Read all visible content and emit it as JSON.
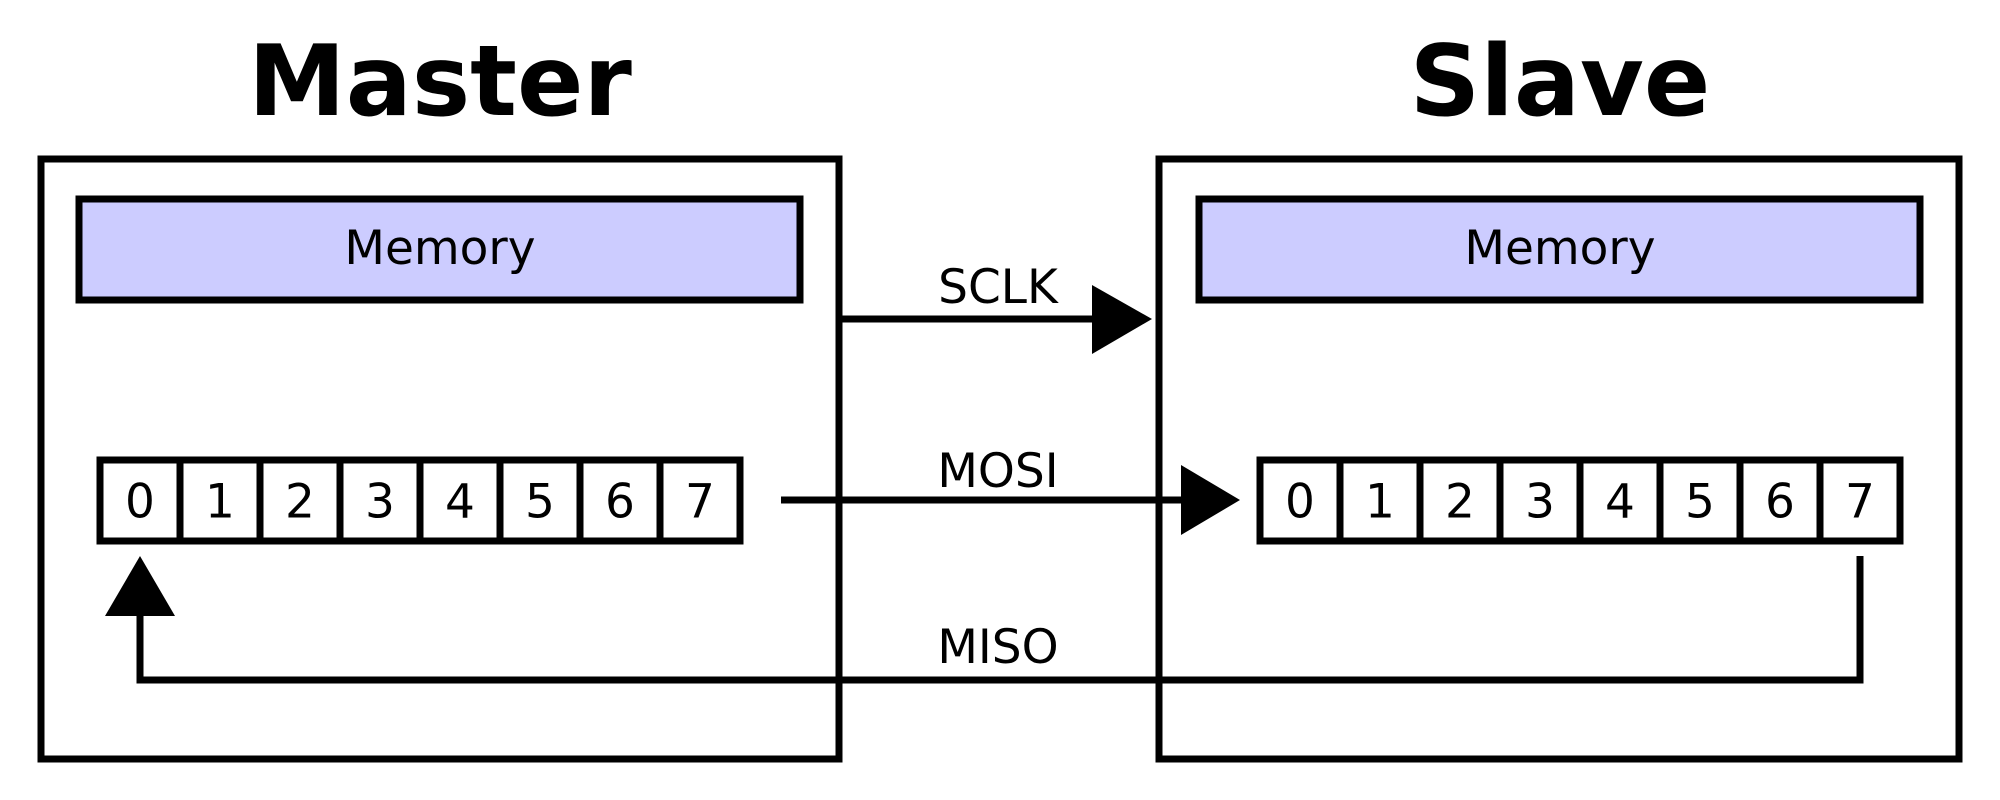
{
  "colors": {
    "memory_fill": "#ccccff",
    "line": "#000000",
    "background": "#ffffff"
  },
  "master": {
    "title": "Master",
    "memory_label": "Memory",
    "register_bits": [
      "0",
      "1",
      "2",
      "3",
      "4",
      "5",
      "6",
      "7"
    ]
  },
  "slave": {
    "title": "Slave",
    "memory_label": "Memory",
    "register_bits": [
      "0",
      "1",
      "2",
      "3",
      "4",
      "5",
      "6",
      "7"
    ]
  },
  "signals": {
    "sclk": "SCLK",
    "mosi": "MOSI",
    "miso": "MISO"
  }
}
